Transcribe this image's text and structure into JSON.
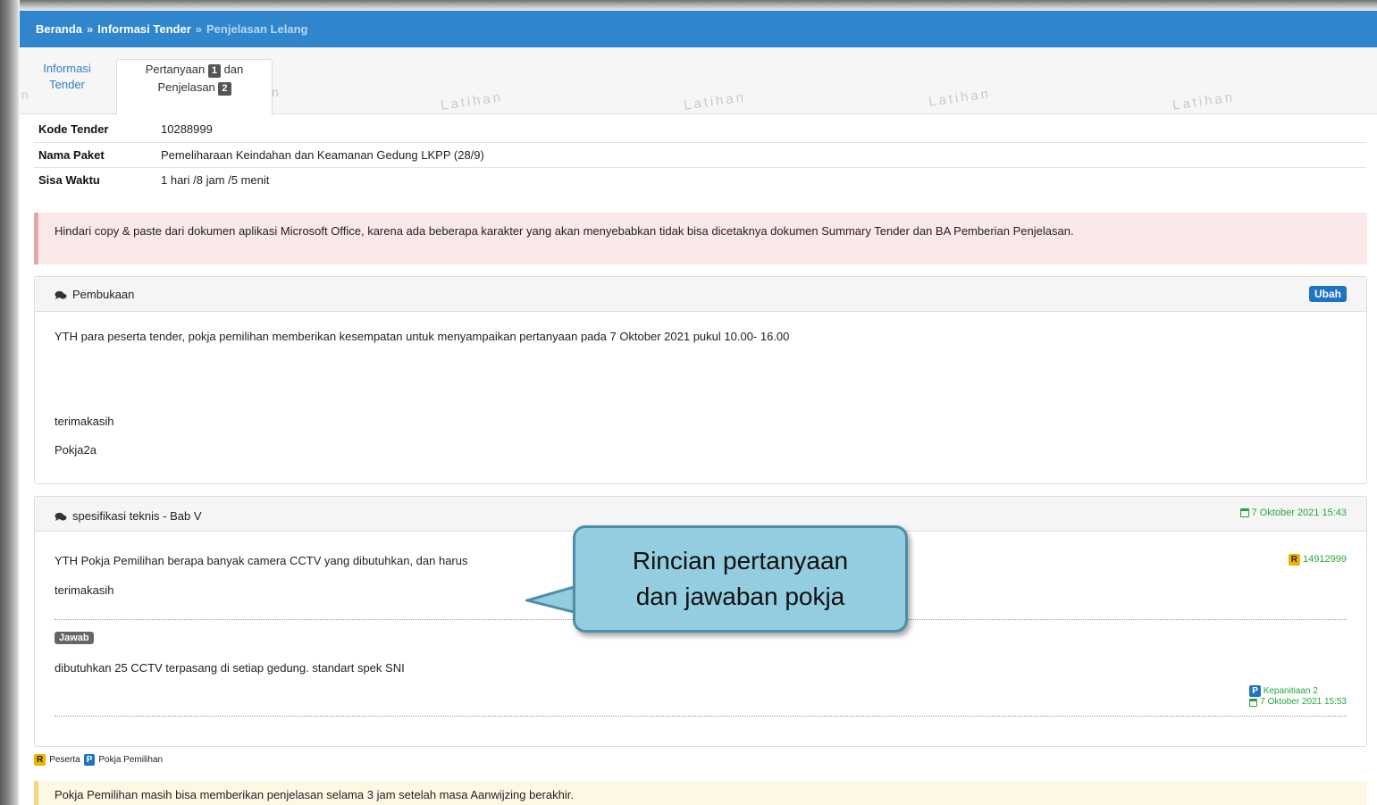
{
  "breadcrumb": {
    "home": "Beranda",
    "separator": "»",
    "section": "Informasi Tender",
    "current": "Penjelasan Lelang"
  },
  "tabs": {
    "info_line1": "Informasi",
    "info_line2": "Tender",
    "active_part1": "Pertanyaan",
    "active_count1": "1",
    "active_part2": "dan",
    "active_part3": "Penjelasan",
    "active_count2": "2"
  },
  "watermark": "Latihan",
  "tender_info": {
    "kode_label": "Kode Tender",
    "kode_value": "10288999",
    "nama_label": "Nama Paket",
    "nama_value": "Pemeliharaan Keindahan dan Keamanan Gedung LKPP (28/9)",
    "sisa_label": "Sisa Waktu",
    "sisa_value": "1 hari /8 jam /5 menit"
  },
  "warning": "Hindari copy & paste dari dokumen aplikasi Microsoft Office, karena ada beberapa karakter yang akan menyebabkan tidak bisa dicetaknya dokumen Summary Tender dan BA Pemberian Penjelasan.",
  "opening_panel": {
    "title": "Pembukaan",
    "edit_label": "Ubah",
    "line1": "YTH para peserta tender, pokja pemilihan memberikan kesempatan untuk menyampaikan pertanyaan pada 7 Oktober 2021 pukul 10.00- 16.00",
    "line2": "terimakasih",
    "line3": "Pokja2a"
  },
  "question_panel": {
    "title": "spesifikasi teknis - Bab V",
    "date": "7 Oktober 2021 15:43",
    "question": "YTH Pokja Pemilihan berapa banyak camera CCTV yang dibutuhkan, dan harus",
    "question_thanks": "terimakasih",
    "asker_badge": "R",
    "asker_id": "14912999",
    "answer_badge": "Jawab",
    "answer": "dibutuhkan 25 CCTV terpasang di setiap gedung. standart spek SNI",
    "responder_badge": "P",
    "responder": "Kepanitiaan 2",
    "answer_date": "7 Oktober 2021 15:53"
  },
  "legend": {
    "r_badge": "R",
    "r_label": "Peserta",
    "p_badge": "P",
    "p_label": "Pokja Pemilihan"
  },
  "note": "Pokja Pemilihan masih bisa memberikan penjelasan selama 3 jam setelah masa Aanwijzing berakhir.",
  "callout": {
    "line1": "Rincian pertanyaan",
    "line2": "dan jawaban pokja"
  },
  "colors": {
    "topbar": "#2f86cd",
    "callout_fill": "#94cde0",
    "callout_border": "#4f8ea8",
    "date_green": "#26a63f"
  }
}
